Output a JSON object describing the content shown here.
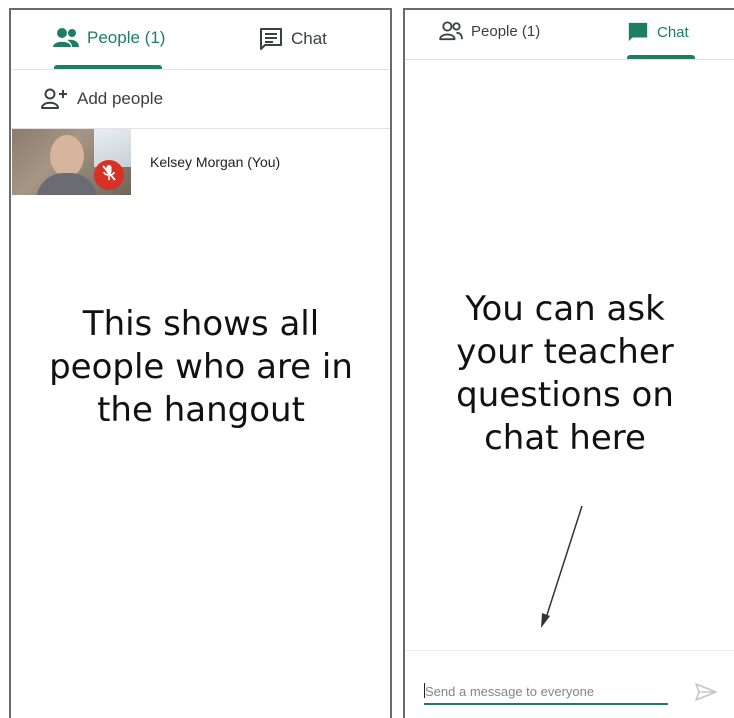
{
  "left_panel": {
    "tabs": {
      "people_label": "People (1)",
      "chat_label": "Chat"
    },
    "add_people_label": "Add people",
    "participant": {
      "name": "Kelsey Morgan (You)",
      "mic_icon": "mic-off-icon"
    },
    "caption": "This shows all people who are in the hangout"
  },
  "right_panel": {
    "tabs": {
      "people_label": "People (1)",
      "chat_label": "Chat"
    },
    "caption": "You can ask your teacher questions on chat here",
    "message_input": {
      "placeholder": "Send a message to everyone",
      "send_icon": "send-icon"
    }
  },
  "colors": {
    "accent": "#1e7e63",
    "mic_off": "#d93025",
    "text_secondary": "#5f6368"
  }
}
